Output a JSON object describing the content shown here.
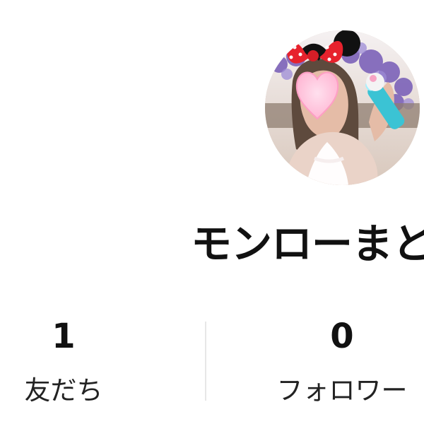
{
  "profile": {
    "name": "モンローまと",
    "avatar_icon": "profile-photo"
  },
  "stats": {
    "friends": {
      "count": "1",
      "label": "友だち"
    },
    "followers": {
      "count": "0",
      "label": "フォロワー"
    }
  },
  "colors": {
    "text": "#111111",
    "background": "#ffffff",
    "divider": "#e7e7e7",
    "heart_sticker": "#ffb7d5"
  }
}
